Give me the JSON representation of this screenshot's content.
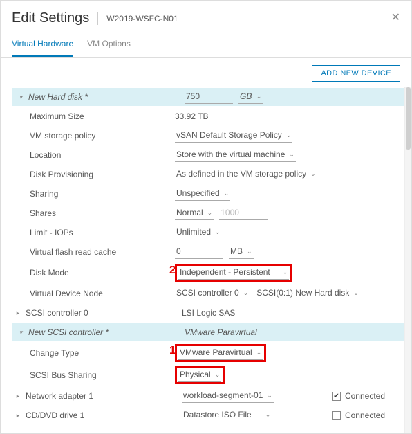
{
  "header": {
    "title": "Edit Settings",
    "subtitle": "W2019-WSFC-N01",
    "close": "✕"
  },
  "tabs": {
    "hardware": "Virtual Hardware",
    "options": "VM Options"
  },
  "toolbar": {
    "add_device": "ADD NEW DEVICE"
  },
  "markers": {
    "m1": "1",
    "m2": "2"
  },
  "disk": {
    "section_label": "New Hard disk *",
    "size_value": "750",
    "size_unit": "GB",
    "max_label": "Maximum Size",
    "max_value": "33.92 TB",
    "policy_label": "VM storage policy",
    "policy_value": "vSAN Default Storage Policy",
    "location_label": "Location",
    "location_value": "Store with the virtual machine",
    "prov_label": "Disk Provisioning",
    "prov_value": "As defined in the VM storage policy",
    "sharing_label": "Sharing",
    "sharing_value": "Unspecified",
    "shares_label": "Shares",
    "shares_value": "Normal",
    "shares_num": "1000",
    "iops_label": "Limit - IOPs",
    "iops_value": "Unlimited",
    "flash_label": "Virtual flash read cache",
    "flash_value": "0",
    "flash_unit": "MB",
    "mode_label": "Disk Mode",
    "mode_value": "Independent - Persistent",
    "node_label": "Virtual Device Node",
    "node_ctrl": "SCSI controller 0",
    "node_slot": "SCSI(0:1) New Hard disk"
  },
  "scsi0": {
    "label": "SCSI controller 0",
    "value": "LSI Logic SAS"
  },
  "newscsi": {
    "section_label": "New SCSI controller *",
    "section_value": "VMware Paravirtual",
    "type_label": "Change Type",
    "type_value": "VMware Paravirtual",
    "bus_label": "SCSI Bus Sharing",
    "bus_value": "Physical"
  },
  "net": {
    "label": "Network adapter 1",
    "value": "workload-segment-01",
    "connected_label": "Connected"
  },
  "cd": {
    "label": "CD/DVD drive 1",
    "value": "Datastore ISO File",
    "connected_label": "Connected"
  }
}
